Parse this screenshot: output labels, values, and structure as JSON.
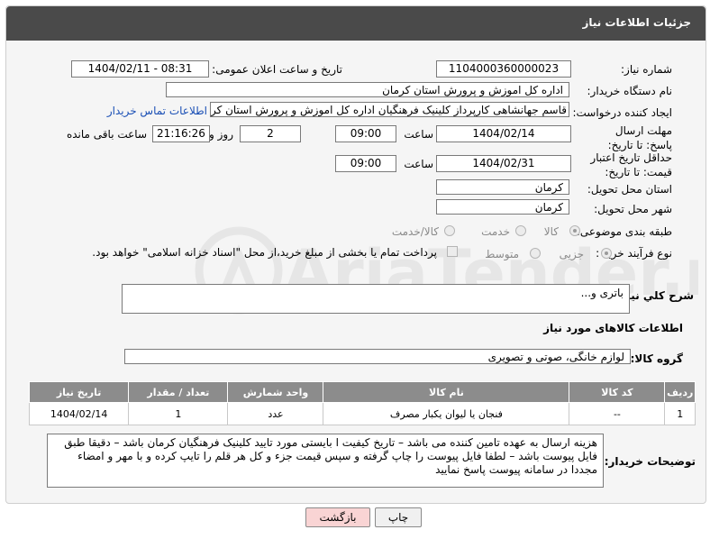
{
  "header": {
    "title": "جزئیات اطلاعات نیاز"
  },
  "fields": {
    "need_number_label": "شماره نیاز:",
    "need_number": "1104000360000023",
    "announce_label": "تاریخ و ساعت اعلان عمومی:",
    "announce_value": "1404/02/11 - 08:31",
    "buyer_org_label": "نام دستگاه خریدار:",
    "buyer_org": "اداره کل اموزش و پرورش استان کرمان",
    "creator_label": "ایجاد کننده درخواست:",
    "creator": "قاسم جهانشاهی کارپرداز کلینیک فرهنگیان اداره کل اموزش و پرورش استان کرمان",
    "contact_link": "اطلاعات تماس خریدار",
    "deadline_label": "مهلت ارسال پاسخ: تا تاریخ:",
    "deadline_date": "1404/02/14",
    "time_label": "ساعت",
    "deadline_time": "09:00",
    "days_value": "2",
    "days_label": "روز و",
    "remaining_time": "21:16:26",
    "remaining_label": "ساعت باقی مانده",
    "min_validity_label": "حداقل تاریخ اعتبار قیمت: تا تاریخ:",
    "validity_date": "1404/02/31",
    "validity_time": "09:00",
    "province_label": "استان محل تحویل:",
    "province": "کرمان",
    "city_label": "شهر محل تحویل:",
    "city": "کرمان",
    "category_label": "طبقه بندی موضوعی:",
    "category_options": [
      "کالا",
      "خدمت",
      "کالا/خدمت"
    ],
    "process_label": "نوع فرآیند خرید :",
    "process_options": [
      "جزیی",
      "متوسط"
    ],
    "payment_note": "پرداخت تمام یا بخشی از مبلغ خرید،از محل \"اسناد خزانه اسلامی\" خواهد بود."
  },
  "description": {
    "label": "شرح کلي نياز:",
    "value": "باتری و..."
  },
  "goods_info": {
    "title": "اطلاعات کالاهای مورد نیاز",
    "group_label": "گروه کالا:",
    "group_value": "لوازم خانگی، صوتی و تصویری"
  },
  "table": {
    "headers": [
      "ردیف",
      "کد کالا",
      "نام کالا",
      "واحد شمارش",
      "تعداد / مقدار",
      "تاریخ نیاز"
    ],
    "rows": [
      [
        "1",
        "--",
        "فنجان یا لیوان یکبار مصرف",
        "عدد",
        "1",
        "1404/02/14"
      ]
    ]
  },
  "buyer_notes": {
    "label": "توضیحات خریدار:",
    "value": "هزینه ارسال به عهده تامین کننده می باشد – تاریخ کیفیت ا بایستی مورد تایید کلینیک فرهنگیان کرمان باشد – دقیقا طبق فایل پیوست باشد – لطفا فایل پیوست را چاپ گرفته و سپس قیمت جزء و کل هر قلم را تایپ کرده و با مهر و امضاء مجددا در سامانه پیوست پاسخ نمایید"
  },
  "buttons": {
    "print": "چاپ",
    "back": "بازگشت"
  },
  "watermark": {
    "text": "AriaTender.neT"
  },
  "colors": {
    "header_bg": "#4a4a4a",
    "table_header_bg": "#8c8c8c",
    "link": "#1a4fb5",
    "back_btn_bg": "#f9d4d4"
  }
}
